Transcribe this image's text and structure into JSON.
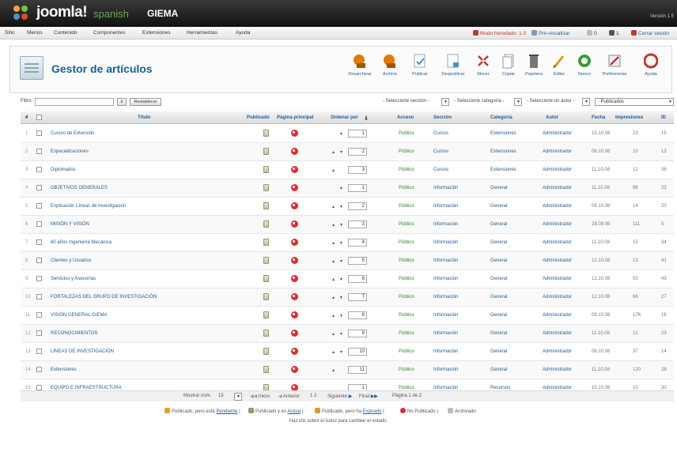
{
  "header": {
    "brand": "joomla!",
    "brand_sub": "spanish",
    "site_name": "GIEMA",
    "version": "Versión 1.5"
  },
  "menubar": {
    "items": [
      "Sitio",
      "Menús",
      "Contenido",
      "Componentes",
      "Extensiones",
      "Herramientas",
      "Ayuda"
    ],
    "status": [
      "Modo heredado: 1.0",
      "Pre-visualizar",
      "0",
      "1",
      "Cerrar sesión"
    ]
  },
  "page": {
    "title": "Gestor de artículos"
  },
  "toolbar": {
    "buttons": [
      {
        "label": "Desarchivar",
        "icon": "unarchive-icon",
        "color": "#e07b00"
      },
      {
        "label": "Archivo",
        "icon": "archive-icon",
        "color": "#e07b00"
      },
      {
        "label": "Publicar",
        "icon": "publish-icon",
        "color": "#4a90c8"
      },
      {
        "label": "Despublicar",
        "icon": "unpublish-icon",
        "color": "#4a90c8"
      },
      {
        "label": "Mover",
        "icon": "move-icon",
        "color": "#c0392b"
      },
      {
        "label": "Copiar",
        "icon": "copy-icon",
        "color": "#888888"
      },
      {
        "label": "Papelera",
        "icon": "trash-icon",
        "color": "#666666"
      },
      {
        "label": "Editar",
        "icon": "edit-icon",
        "color": "#d4a017"
      },
      {
        "label": "Nuevo",
        "icon": "new-icon",
        "color": "#3a9a3a"
      },
      {
        "label": "Preferencias",
        "icon": "preferences-icon",
        "color": "#777777"
      },
      {
        "label": "Ayuda",
        "icon": "help-icon",
        "color": "#c0392b"
      }
    ]
  },
  "filter": {
    "label": "Filtro:",
    "go": "Ir",
    "reset": "Restablecer",
    "section": "- Seleccione sección -",
    "category": "- Seleccione categoría -",
    "author": "- Seleccione un autor -",
    "state": "- Publicados"
  },
  "table": {
    "headers": [
      "#",
      "Título",
      "Publicado",
      "Página principal",
      "Ordenar por",
      "Acceso",
      "Sección",
      "Categoría",
      "Autor",
      "Fecha",
      "Impresiones",
      "ID"
    ],
    "rows": [
      {
        "n": "1",
        "title": "Cursos de Extensión",
        "order": "1",
        "access": "Público",
        "section": "Cursos",
        "category": "Extensiones",
        "author": "Administrador",
        "date": "15.10.08",
        "hits": "23",
        "id": "15"
      },
      {
        "n": "2",
        "title": "Especializaciones",
        "order": "2",
        "access": "Público",
        "section": "Cursos",
        "category": "Extensiones",
        "author": "Administrador",
        "date": "06.10.08",
        "hits": "10",
        "id": "13"
      },
      {
        "n": "3",
        "title": "Diplomados",
        "order": "3",
        "access": "Público",
        "section": "Cursos",
        "category": "Extensiones",
        "author": "Administrador",
        "date": "11.10.08",
        "hits": "12",
        "id": "36"
      },
      {
        "n": "4",
        "title": "OBJETIVOS GENERALES",
        "order": "1",
        "access": "Público",
        "section": "Información",
        "category": "General",
        "author": "Administrador",
        "date": "11.10.08",
        "hits": "96",
        "id": "22"
      },
      {
        "n": "5",
        "title": "Explicación Líneas de Investigación",
        "order": "2",
        "access": "Público",
        "section": "Información",
        "category": "General",
        "author": "Administrador",
        "date": "09.10.08",
        "hits": "14",
        "id": "20"
      },
      {
        "n": "6",
        "title": "MISIÓN Y VISIÓN",
        "order": "3",
        "access": "Público",
        "section": "Información",
        "category": "General",
        "author": "Administrador",
        "date": "28.09.08",
        "hits": "111",
        "id": "5"
      },
      {
        "n": "7",
        "title": "60 años Ingeniería Mecánica",
        "order": "4",
        "access": "Público",
        "section": "Información",
        "category": "General",
        "author": "Administrador",
        "date": "11.10.08",
        "hits": "15",
        "id": "34"
      },
      {
        "n": "8",
        "title": "Clientes y Usuarios",
        "order": "5",
        "access": "Público",
        "section": "Información",
        "category": "General",
        "author": "Administrador",
        "date": "12.10.08",
        "hits": "13",
        "id": "41"
      },
      {
        "n": "9",
        "title": "Servicios y Asesorías",
        "order": "6",
        "access": "Público",
        "section": "Información",
        "category": "General",
        "author": "Administrador",
        "date": "12.10.08",
        "hits": "50",
        "id": "43"
      },
      {
        "n": "10",
        "title": "FORTALEZAS DEL GRUPO DE INVESTIGACIÓN",
        "order": "7",
        "access": "Público",
        "section": "Información",
        "category": "General",
        "author": "Administrador",
        "date": "12.10.08",
        "hits": "66",
        "id": "27"
      },
      {
        "n": "11",
        "title": "VISIÓN GENERAL GIEMA",
        "order": "8",
        "access": "Público",
        "section": "Información",
        "category": "General",
        "author": "Administrador",
        "date": "09.10.08",
        "hits": "176",
        "id": "16"
      },
      {
        "n": "12",
        "title": "RECONOCIMIENTOS",
        "order": "9",
        "access": "Público",
        "section": "Información",
        "category": "General",
        "author": "Administrador",
        "date": "11.10.08",
        "hits": "21",
        "id": "23"
      },
      {
        "n": "13",
        "title": "LÍNEAS DE INVESTIGACIÓN",
        "order": "10",
        "access": "Público",
        "section": "Información",
        "category": "General",
        "author": "Administrador",
        "date": "06.10.08",
        "hits": "37",
        "id": "14"
      },
      {
        "n": "14",
        "title": "Extensiones",
        "order": "11",
        "access": "Público",
        "section": "Información",
        "category": "General",
        "author": "Administrador",
        "date": "11.10.08",
        "hits": "120",
        "id": "28"
      },
      {
        "n": "15",
        "title": "EQUIPO E INFRAESTRUCTURA",
        "order": "1",
        "access": "Público",
        "section": "Información",
        "category": "Recursos",
        "author": "Administrador",
        "date": "10.10.08",
        "hits": "10",
        "id": "30"
      }
    ]
  },
  "pager": {
    "display_label": "Mostrar núm.",
    "display_value": "15",
    "start": "Inicio",
    "prev": "Anterior",
    "pages": "1 2",
    "next": "Siguiente",
    "end": "Final",
    "page_info": "Página 1 de 2"
  },
  "legend": {
    "pending": "Publicado, pero está",
    "pending_u": "Pendiente",
    "current": "Publicado y es",
    "current_u": "Actual",
    "expired": "Publicado, pero ha",
    "expired_u": "Expirado",
    "unpublished": "No Publicado",
    "archived": "Archivado",
    "hint": "Haz clic sobre el icono para cambiar el estado."
  }
}
